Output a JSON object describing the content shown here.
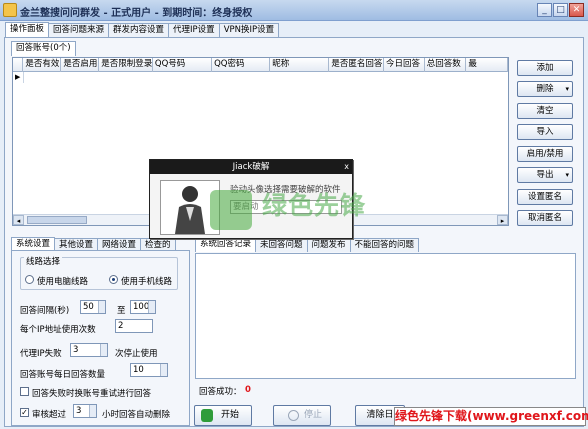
{
  "window": {
    "title": "金兰整搜问问群发 - 正式用户 - 到期时间：终身授权",
    "min_glyph": "_",
    "max_glyph": "□",
    "close_glyph": "✕"
  },
  "main_tabs": [
    "操作面板",
    "回答问题来源",
    "群发内容设置",
    "代理IP设置",
    "VPN换IP设置"
  ],
  "account_tab": "回答账号(0个)",
  "grid": {
    "row_marker": "▶",
    "columns": [
      "是否有效",
      "是否启用",
      "是否限制登录",
      "QQ号码",
      "QQ密码",
      "昵称",
      "是否匿名回答",
      "今日回答",
      "总回答数",
      "最"
    ],
    "scroll_left": "◂",
    "scroll_right": "▸"
  },
  "right_buttons": [
    {
      "label": "添加",
      "dropdown": false
    },
    {
      "label": "删除",
      "dropdown": true
    },
    {
      "label": "清空",
      "dropdown": false
    },
    {
      "label": "导入",
      "dropdown": false
    },
    {
      "label": "启用/禁用",
      "dropdown": false
    },
    {
      "label": "导出",
      "dropdown": true
    },
    {
      "label": "设置匿名",
      "dropdown": false
    },
    {
      "label": "取消匿名",
      "dropdown": false
    }
  ],
  "dropdown_glyph": "▾",
  "settings_tabs": [
    "系统设置",
    "其他设置",
    "网络设置",
    "检查的"
  ],
  "log_tabs": [
    "系统回答记录",
    "未回答问题",
    "问题发布",
    "不能回答的问题"
  ],
  "settings": {
    "line_legend": "线路选择",
    "line_pc": "使用电脑线路",
    "line_mobile": "使用手机线路",
    "interval_label": "回答间隔(秒)",
    "interval_from": "50",
    "interval_to_label": "至",
    "interval_to": "100",
    "per_ip_label": "每个IP地址使用次数",
    "per_ip": "2",
    "proxy_fail_prefix": "代理IP失败",
    "proxy_fail": "3",
    "proxy_fail_suffix": "次停止使用",
    "daily_label": "回答账号每日回答数量",
    "daily": "10",
    "retry_label": "回答失败时换账号重试进行回答",
    "review_label": "审核超过",
    "review_hours": "3",
    "review_suffix": "小时回答自动删除",
    "check_mark": "✓"
  },
  "log": {
    "success_label": "回答成功：",
    "success_count": "0"
  },
  "bottom_buttons": {
    "start": "开始",
    "stop": "停止",
    "clear": "清除日"
  },
  "dialog": {
    "title": "Jiack破解",
    "close": "x",
    "message": "验动头像选择需要破解的软件",
    "input": "要启动"
  },
  "watermark": {
    "brand": "绿色先锋",
    "site": "绿色先锋下载(www.greenxf.com)"
  },
  "colors": {
    "title_text": "#1d2f55",
    "success_count": "#e0161b",
    "watermark": "#48aa48"
  }
}
